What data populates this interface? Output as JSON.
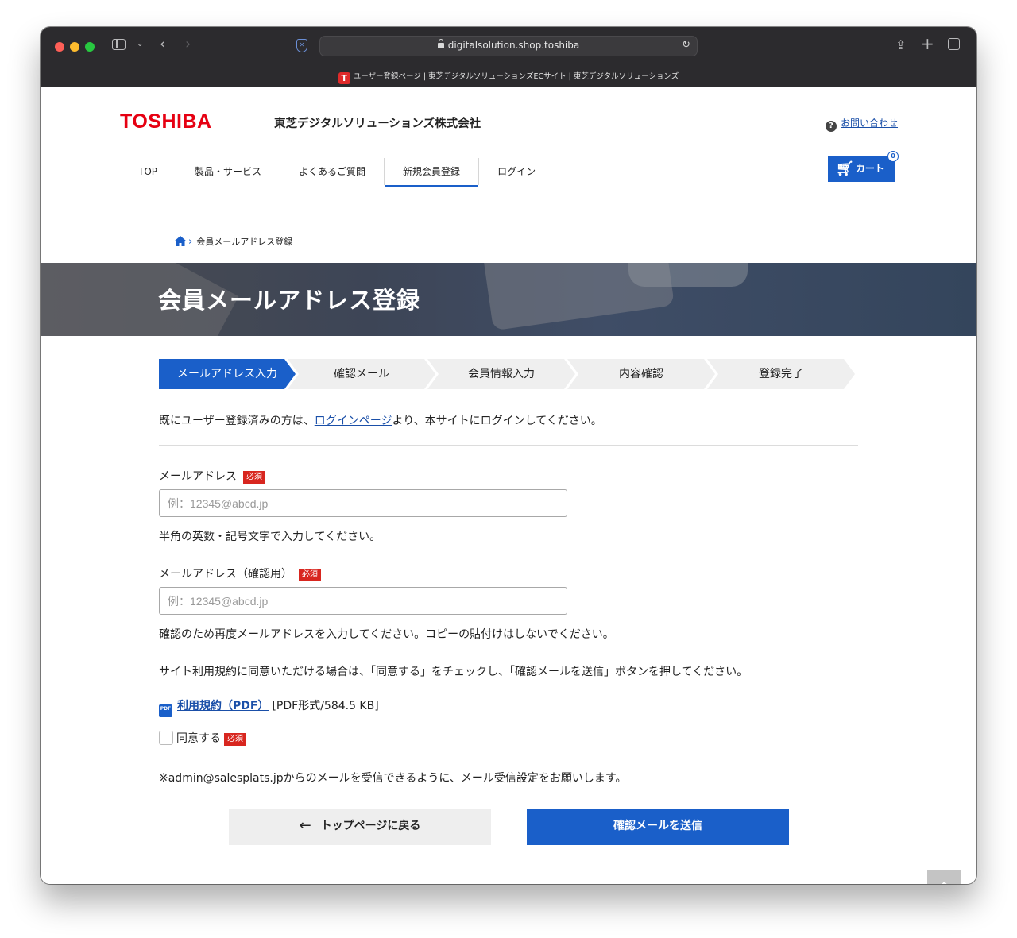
{
  "browser": {
    "url": "digitalsolution.shop.toshiba",
    "tab_title": "ユーザー登録ページ | 東芝デジタルソリューションズECサイト | 東芝デジタルソリューションズ",
    "favicon_letter": "T"
  },
  "header": {
    "logo": "TOSHIBA",
    "company": "東芝デジタルソリューションズ株式会社",
    "contact_label": "お問い合わせ",
    "contact_icon": "?"
  },
  "nav": {
    "items": [
      {
        "label": "TOP"
      },
      {
        "label": "製品・サービス"
      },
      {
        "label": "よくあるご質問"
      },
      {
        "label": "新規会員登録",
        "active": true
      },
      {
        "label": "ログイン"
      }
    ]
  },
  "cart": {
    "label": "カート",
    "count": "0"
  },
  "breadcrumb": {
    "current": "会員メールアドレス登録"
  },
  "hero": {
    "title": "会員メールアドレス登録"
  },
  "steps": [
    {
      "label": "メールアドレス入力",
      "active": true
    },
    {
      "label": "確認メール"
    },
    {
      "label": "会員情報入力"
    },
    {
      "label": "内容確認"
    },
    {
      "label": "登録完了"
    }
  ],
  "intro": {
    "before": "既にユーザー登録済みの方は、",
    "link": "ログインページ",
    "after": "より、本サイトにログインしてください。"
  },
  "form": {
    "required_badge": "必須",
    "email_label": "メールアドレス",
    "email_placeholder": "例：12345@abcd.jp",
    "email_help": "半角の英数・記号文字で入力してください。",
    "email_confirm_label": "メールアドレス（確認用）",
    "email_confirm_placeholder": "例：12345@abcd.jp",
    "email_confirm_help": "確認のため再度メールアドレスを入力してください。コピーの貼付けはしないでください。",
    "terms_instruction": "サイト利用規約に同意いただける場合は、「同意する」をチェックし、「確認メールを送信」ボタンを押してください。",
    "pdf_icon_text": "PDF",
    "terms_link": "利用規約（PDF）",
    "terms_meta": "[PDF形式/584.5 KB]",
    "agree_label": "同意する",
    "agree_checked": false,
    "mail_notice": "※admin@salesplats.jpからのメールを受信できるように、メール受信設定をお願いします。"
  },
  "buttons": {
    "back_arrow": "←",
    "back_label": "トップページに戻る",
    "send_label": "確認メールを送信"
  }
}
